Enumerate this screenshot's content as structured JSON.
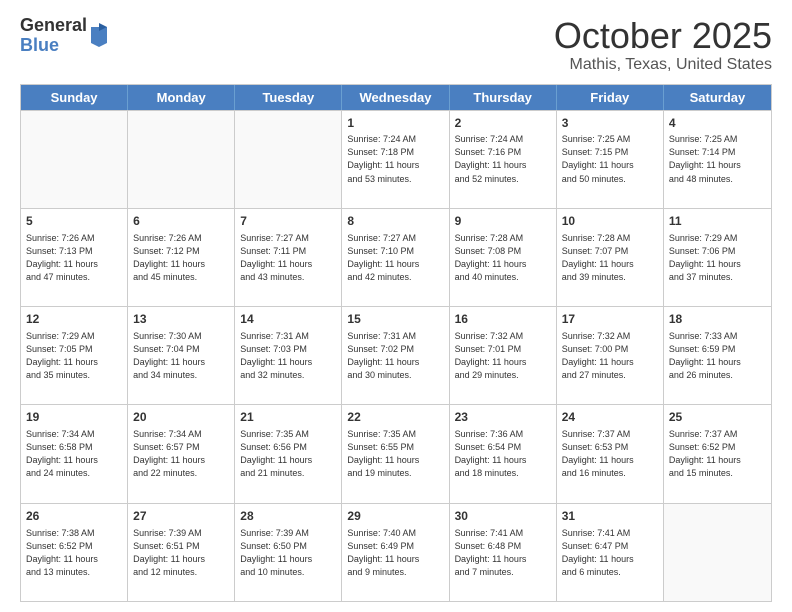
{
  "logo": {
    "general": "General",
    "blue": "Blue"
  },
  "header": {
    "month": "October 2025",
    "location": "Mathis, Texas, United States"
  },
  "weekdays": [
    "Sunday",
    "Monday",
    "Tuesday",
    "Wednesday",
    "Thursday",
    "Friday",
    "Saturday"
  ],
  "rows": [
    [
      {
        "day": "",
        "info": ""
      },
      {
        "day": "",
        "info": ""
      },
      {
        "day": "",
        "info": ""
      },
      {
        "day": "1",
        "info": "Sunrise: 7:24 AM\nSunset: 7:18 PM\nDaylight: 11 hours\nand 53 minutes."
      },
      {
        "day": "2",
        "info": "Sunrise: 7:24 AM\nSunset: 7:16 PM\nDaylight: 11 hours\nand 52 minutes."
      },
      {
        "day": "3",
        "info": "Sunrise: 7:25 AM\nSunset: 7:15 PM\nDaylight: 11 hours\nand 50 minutes."
      },
      {
        "day": "4",
        "info": "Sunrise: 7:25 AM\nSunset: 7:14 PM\nDaylight: 11 hours\nand 48 minutes."
      }
    ],
    [
      {
        "day": "5",
        "info": "Sunrise: 7:26 AM\nSunset: 7:13 PM\nDaylight: 11 hours\nand 47 minutes."
      },
      {
        "day": "6",
        "info": "Sunrise: 7:26 AM\nSunset: 7:12 PM\nDaylight: 11 hours\nand 45 minutes."
      },
      {
        "day": "7",
        "info": "Sunrise: 7:27 AM\nSunset: 7:11 PM\nDaylight: 11 hours\nand 43 minutes."
      },
      {
        "day": "8",
        "info": "Sunrise: 7:27 AM\nSunset: 7:10 PM\nDaylight: 11 hours\nand 42 minutes."
      },
      {
        "day": "9",
        "info": "Sunrise: 7:28 AM\nSunset: 7:08 PM\nDaylight: 11 hours\nand 40 minutes."
      },
      {
        "day": "10",
        "info": "Sunrise: 7:28 AM\nSunset: 7:07 PM\nDaylight: 11 hours\nand 39 minutes."
      },
      {
        "day": "11",
        "info": "Sunrise: 7:29 AM\nSunset: 7:06 PM\nDaylight: 11 hours\nand 37 minutes."
      }
    ],
    [
      {
        "day": "12",
        "info": "Sunrise: 7:29 AM\nSunset: 7:05 PM\nDaylight: 11 hours\nand 35 minutes."
      },
      {
        "day": "13",
        "info": "Sunrise: 7:30 AM\nSunset: 7:04 PM\nDaylight: 11 hours\nand 34 minutes."
      },
      {
        "day": "14",
        "info": "Sunrise: 7:31 AM\nSunset: 7:03 PM\nDaylight: 11 hours\nand 32 minutes."
      },
      {
        "day": "15",
        "info": "Sunrise: 7:31 AM\nSunset: 7:02 PM\nDaylight: 11 hours\nand 30 minutes."
      },
      {
        "day": "16",
        "info": "Sunrise: 7:32 AM\nSunset: 7:01 PM\nDaylight: 11 hours\nand 29 minutes."
      },
      {
        "day": "17",
        "info": "Sunrise: 7:32 AM\nSunset: 7:00 PM\nDaylight: 11 hours\nand 27 minutes."
      },
      {
        "day": "18",
        "info": "Sunrise: 7:33 AM\nSunset: 6:59 PM\nDaylight: 11 hours\nand 26 minutes."
      }
    ],
    [
      {
        "day": "19",
        "info": "Sunrise: 7:34 AM\nSunset: 6:58 PM\nDaylight: 11 hours\nand 24 minutes."
      },
      {
        "day": "20",
        "info": "Sunrise: 7:34 AM\nSunset: 6:57 PM\nDaylight: 11 hours\nand 22 minutes."
      },
      {
        "day": "21",
        "info": "Sunrise: 7:35 AM\nSunset: 6:56 PM\nDaylight: 11 hours\nand 21 minutes."
      },
      {
        "day": "22",
        "info": "Sunrise: 7:35 AM\nSunset: 6:55 PM\nDaylight: 11 hours\nand 19 minutes."
      },
      {
        "day": "23",
        "info": "Sunrise: 7:36 AM\nSunset: 6:54 PM\nDaylight: 11 hours\nand 18 minutes."
      },
      {
        "day": "24",
        "info": "Sunrise: 7:37 AM\nSunset: 6:53 PM\nDaylight: 11 hours\nand 16 minutes."
      },
      {
        "day": "25",
        "info": "Sunrise: 7:37 AM\nSunset: 6:52 PM\nDaylight: 11 hours\nand 15 minutes."
      }
    ],
    [
      {
        "day": "26",
        "info": "Sunrise: 7:38 AM\nSunset: 6:52 PM\nDaylight: 11 hours\nand 13 minutes."
      },
      {
        "day": "27",
        "info": "Sunrise: 7:39 AM\nSunset: 6:51 PM\nDaylight: 11 hours\nand 12 minutes."
      },
      {
        "day": "28",
        "info": "Sunrise: 7:39 AM\nSunset: 6:50 PM\nDaylight: 11 hours\nand 10 minutes."
      },
      {
        "day": "29",
        "info": "Sunrise: 7:40 AM\nSunset: 6:49 PM\nDaylight: 11 hours\nand 9 minutes."
      },
      {
        "day": "30",
        "info": "Sunrise: 7:41 AM\nSunset: 6:48 PM\nDaylight: 11 hours\nand 7 minutes."
      },
      {
        "day": "31",
        "info": "Sunrise: 7:41 AM\nSunset: 6:47 PM\nDaylight: 11 hours\nand 6 minutes."
      },
      {
        "day": "",
        "info": ""
      }
    ]
  ]
}
